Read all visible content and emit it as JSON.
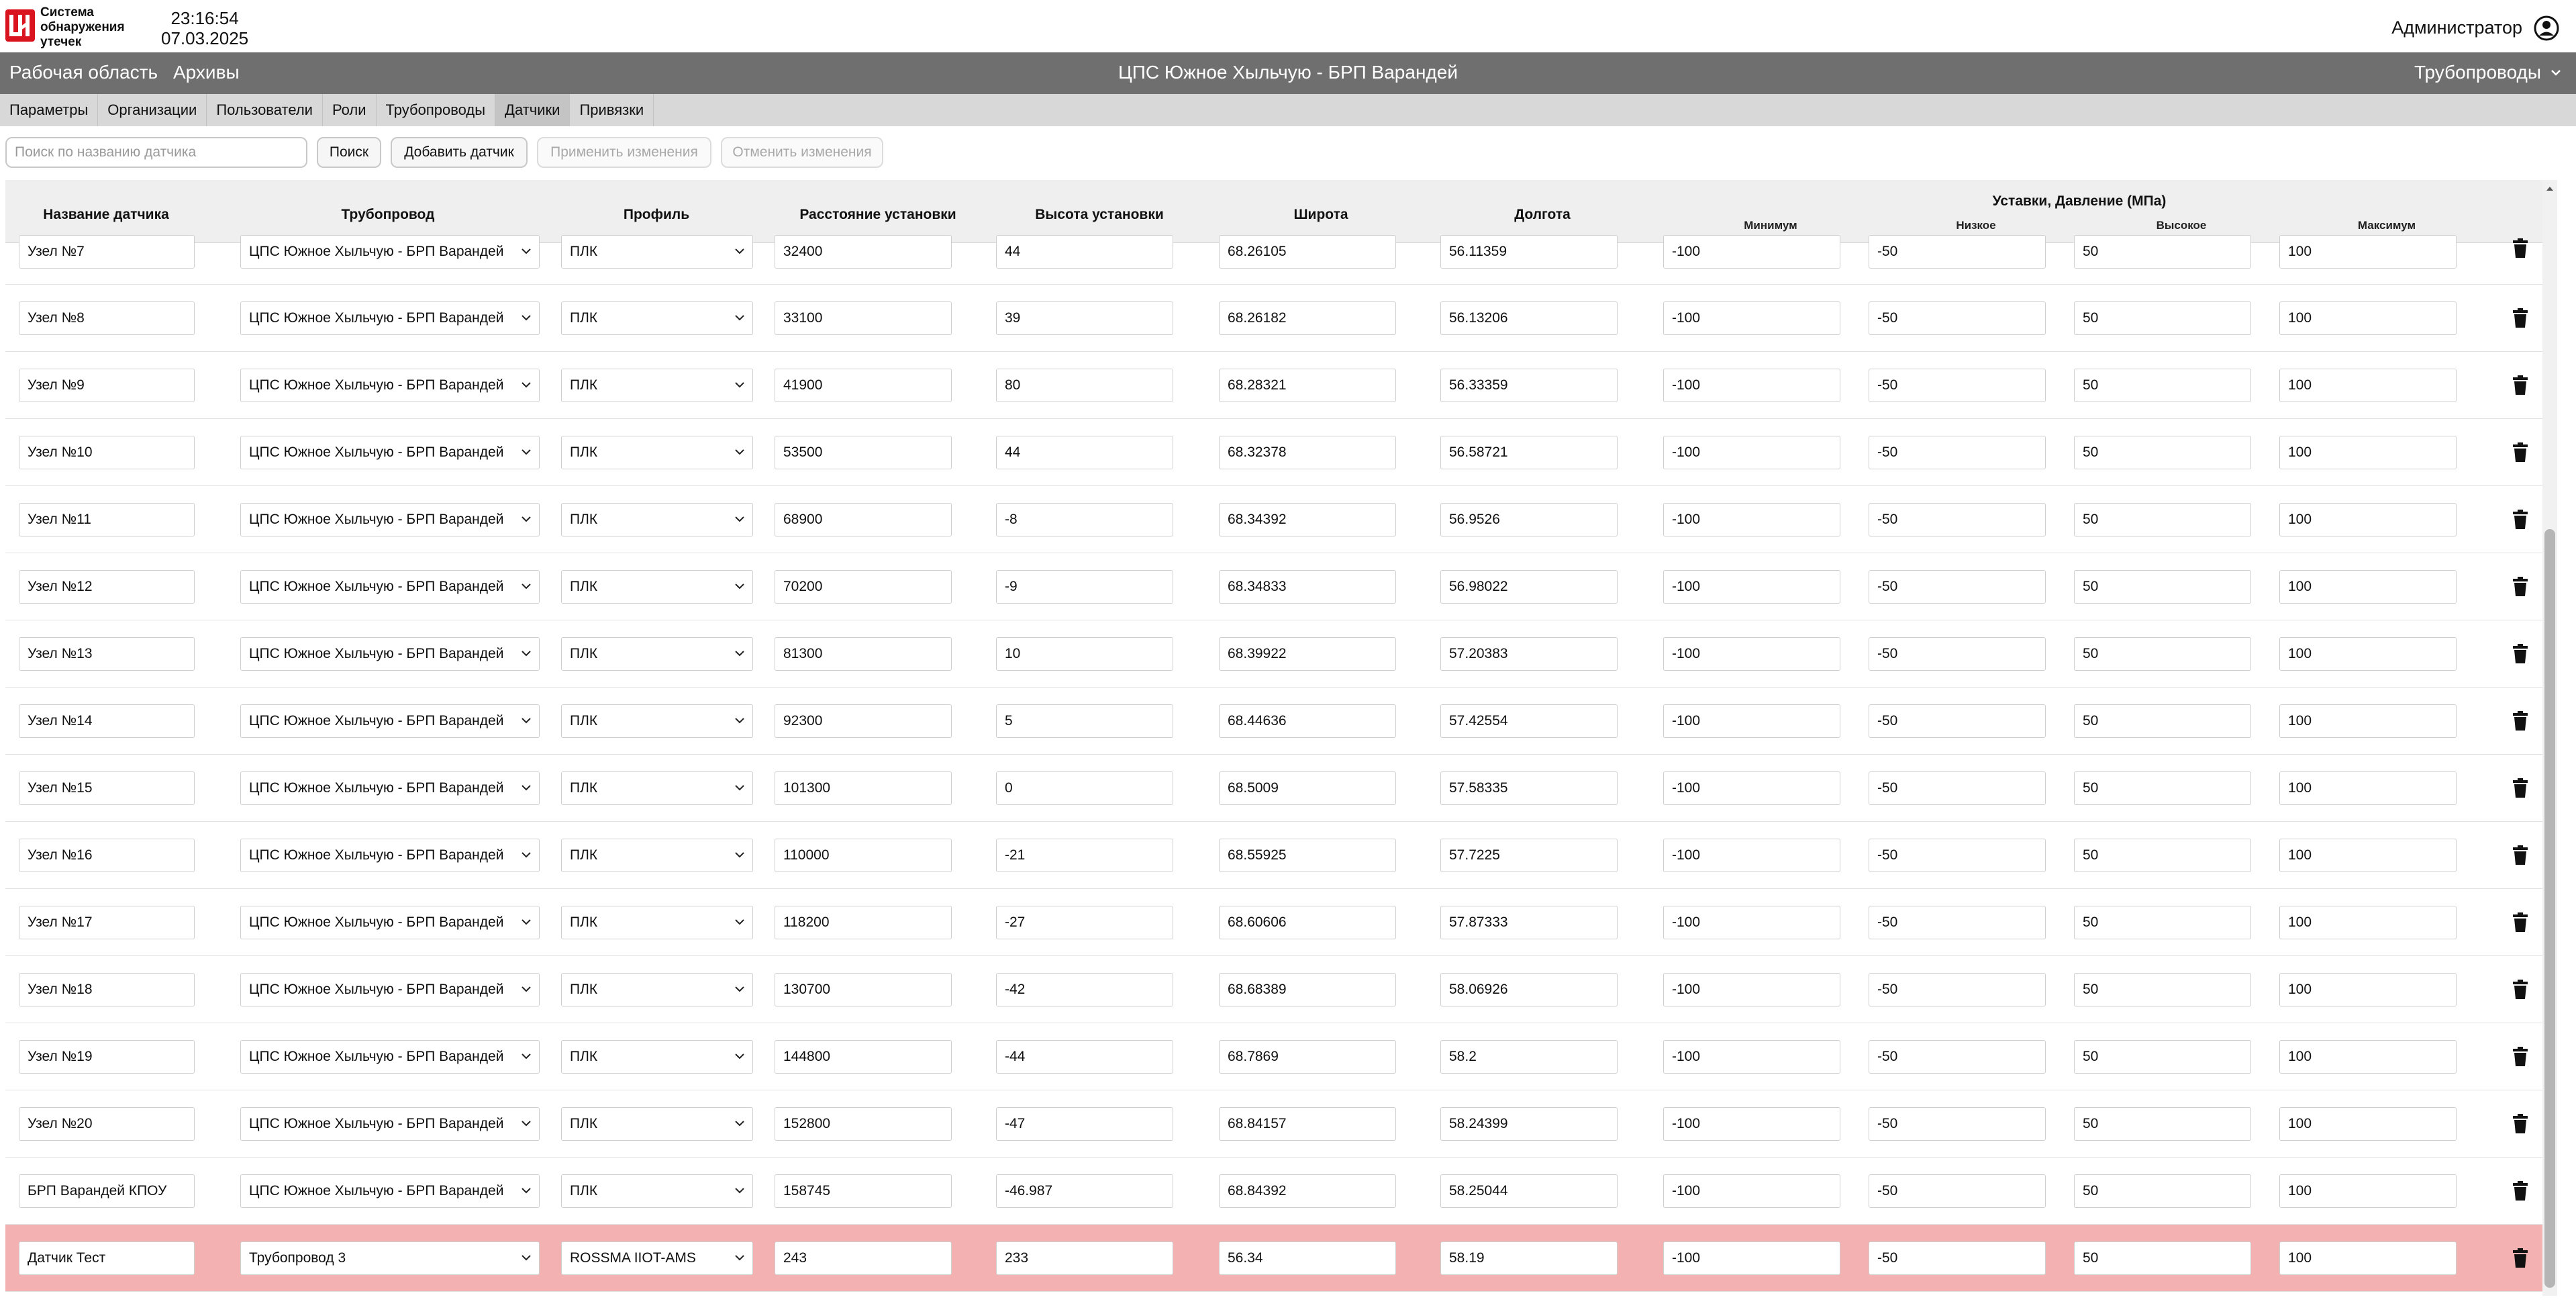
{
  "header": {
    "logo_text": "Система обнаружения утечек",
    "time": "23:16:54",
    "date": "07.03.2025",
    "user": "Администратор"
  },
  "nav": {
    "workspace": "Рабочая область",
    "archives": "Архивы",
    "title": "ЦПС Южное Хыльчую - БРП Варандей",
    "pipelines": "Трубопроводы"
  },
  "tabs": [
    "Параметры",
    "Организации",
    "Пользователи",
    "Роли",
    "Трубопроводы",
    "Датчики",
    "Привязки"
  ],
  "active_tab": "Датчики",
  "toolbar": {
    "search_placeholder": "Поиск по названию датчика",
    "search_button": "Поиск",
    "add_button": "Добавить датчик",
    "apply_button": "Применить изменения",
    "cancel_button": "Отменить изменения"
  },
  "columns": {
    "name": "Название датчика",
    "pipeline": "Трубопровод",
    "profile": "Профиль",
    "distance": "Расстояние установки",
    "height": "Высота установки",
    "latitude": "Широта",
    "longitude": "Долгота",
    "setpoints_group": "Уставки, Давление (МПа)",
    "min": "Минимум",
    "low": "Низкое",
    "high": "Высокое",
    "max": "Максимум"
  },
  "rows": [
    {
      "name": "Узел №7",
      "pipeline": "ЦПС Южное Хыльчую - БРП Варандей",
      "profile": "ПЛК",
      "distance": "32400",
      "height": "44",
      "lat": "68.26105",
      "lon": "56.11359",
      "min": "-100",
      "low": "-50",
      "high": "50",
      "max": "100"
    },
    {
      "name": "Узел №8",
      "pipeline": "ЦПС Южное Хыльчую - БРП Варандей",
      "profile": "ПЛК",
      "distance": "33100",
      "height": "39",
      "lat": "68.26182",
      "lon": "56.13206",
      "min": "-100",
      "low": "-50",
      "high": "50",
      "max": "100"
    },
    {
      "name": "Узел №9",
      "pipeline": "ЦПС Южное Хыльчую - БРП Варандей",
      "profile": "ПЛК",
      "distance": "41900",
      "height": "80",
      "lat": "68.28321",
      "lon": "56.33359",
      "min": "-100",
      "low": "-50",
      "high": "50",
      "max": "100"
    },
    {
      "name": "Узел №10",
      "pipeline": "ЦПС Южное Хыльчую - БРП Варандей",
      "profile": "ПЛК",
      "distance": "53500",
      "height": "44",
      "lat": "68.32378",
      "lon": "56.58721",
      "min": "-100",
      "low": "-50",
      "high": "50",
      "max": "100"
    },
    {
      "name": "Узел №11",
      "pipeline": "ЦПС Южное Хыльчую - БРП Варандей",
      "profile": "ПЛК",
      "distance": "68900",
      "height": "-8",
      "lat": "68.34392",
      "lon": "56.9526",
      "min": "-100",
      "low": "-50",
      "high": "50",
      "max": "100"
    },
    {
      "name": "Узел №12",
      "pipeline": "ЦПС Южное Хыльчую - БРП Варандей",
      "profile": "ПЛК",
      "distance": "70200",
      "height": "-9",
      "lat": "68.34833",
      "lon": "56.98022",
      "min": "-100",
      "low": "-50",
      "high": "50",
      "max": "100"
    },
    {
      "name": "Узел №13",
      "pipeline": "ЦПС Южное Хыльчую - БРП Варандей",
      "profile": "ПЛК",
      "distance": "81300",
      "height": "10",
      "lat": "68.39922",
      "lon": "57.20383",
      "min": "-100",
      "low": "-50",
      "high": "50",
      "max": "100"
    },
    {
      "name": "Узел №14",
      "pipeline": "ЦПС Южное Хыльчую - БРП Варандей",
      "profile": "ПЛК",
      "distance": "92300",
      "height": "5",
      "lat": "68.44636",
      "lon": "57.42554",
      "min": "-100",
      "low": "-50",
      "high": "50",
      "max": "100"
    },
    {
      "name": "Узел №15",
      "pipeline": "ЦПС Южное Хыльчую - БРП Варандей",
      "profile": "ПЛК",
      "distance": "101300",
      "height": "0",
      "lat": "68.5009",
      "lon": "57.58335",
      "min": "-100",
      "low": "-50",
      "high": "50",
      "max": "100"
    },
    {
      "name": "Узел №16",
      "pipeline": "ЦПС Южное Хыльчую - БРП Варандей",
      "profile": "ПЛК",
      "distance": "110000",
      "height": "-21",
      "lat": "68.55925",
      "lon": "57.7225",
      "min": "-100",
      "low": "-50",
      "high": "50",
      "max": "100"
    },
    {
      "name": "Узел №17",
      "pipeline": "ЦПС Южное Хыльчую - БРП Варандей",
      "profile": "ПЛК",
      "distance": "118200",
      "height": "-27",
      "lat": "68.60606",
      "lon": "57.87333",
      "min": "-100",
      "low": "-50",
      "high": "50",
      "max": "100"
    },
    {
      "name": "Узел №18",
      "pipeline": "ЦПС Южное Хыльчую - БРП Варандей",
      "profile": "ПЛК",
      "distance": "130700",
      "height": "-42",
      "lat": "68.68389",
      "lon": "58.06926",
      "min": "-100",
      "low": "-50",
      "high": "50",
      "max": "100"
    },
    {
      "name": "Узел №19",
      "pipeline": "ЦПС Южное Хыльчую - БРП Варандей",
      "profile": "ПЛК",
      "distance": "144800",
      "height": "-44",
      "lat": "68.7869",
      "lon": "58.2",
      "min": "-100",
      "low": "-50",
      "high": "50",
      "max": "100"
    },
    {
      "name": "Узел №20",
      "pipeline": "ЦПС Южное Хыльчую - БРП Варандей",
      "profile": "ПЛК",
      "distance": "152800",
      "height": "-47",
      "lat": "68.84157",
      "lon": "58.24399",
      "min": "-100",
      "low": "-50",
      "high": "50",
      "max": "100"
    },
    {
      "name": "БРП Варандей КПОУ",
      "pipeline": "ЦПС Южное Хыльчую - БРП Варандей",
      "profile": "ПЛК",
      "distance": "158745",
      "height": "-46.987",
      "lat": "68.84392",
      "lon": "58.25044",
      "min": "-100",
      "low": "-50",
      "high": "50",
      "max": "100"
    },
    {
      "name": "Датчик Тест",
      "pipeline": "Трубопровод 3",
      "profile": "ROSSMA IIOT-AMS",
      "distance": "243",
      "height": "233",
      "lat": "56.34",
      "lon": "58.19",
      "min": "-100",
      "low": "-50",
      "high": "50",
      "max": "100",
      "highlight": true
    }
  ],
  "colors": {
    "nav_bg": "#6f6f6f",
    "tabs_bg": "#d8d8d8",
    "highlight_row": "#f4b1b1",
    "brand_red": "#d9141e"
  },
  "icons": {
    "logo": "lukoil-logo-icon",
    "user": "user-circle-icon",
    "dropdown": "chevron-down-icon",
    "delete": "trash-icon"
  }
}
